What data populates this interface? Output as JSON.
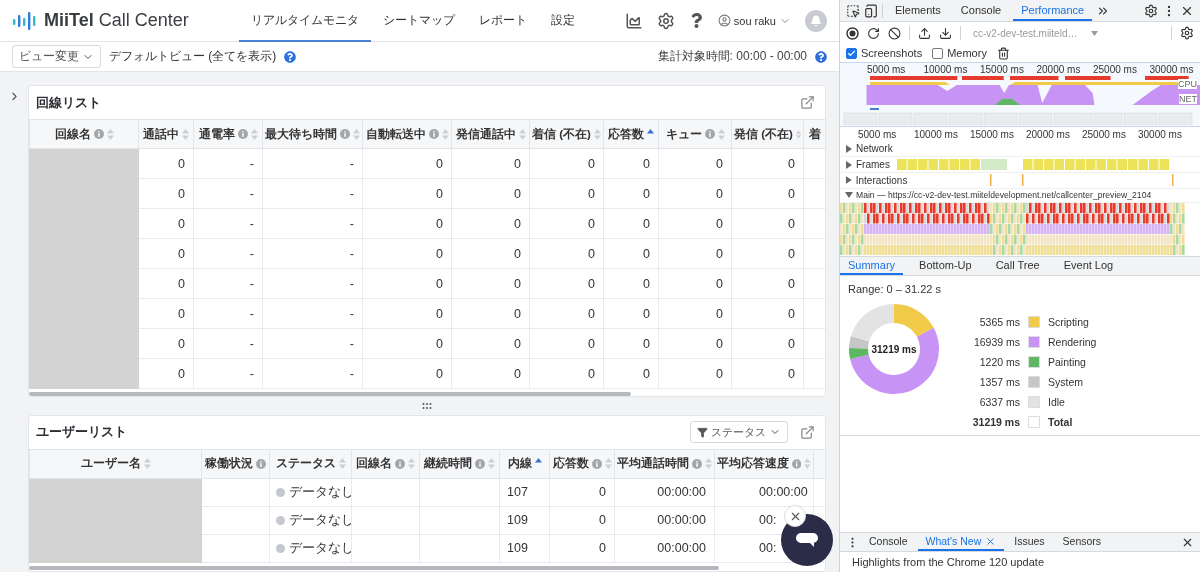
{
  "header": {
    "logo": "**MiiTel** Call Center",
    "nav": [
      {
        "label": "リアルタイムモニタ",
        "selected": true
      },
      {
        "label": "シートマップ",
        "selected": false
      },
      {
        "label": "レポート",
        "selected": false
      },
      {
        "label": "設定",
        "selected": false
      }
    ],
    "user": "sou raku"
  },
  "toolbar": {
    "view_button": "ビュー変更",
    "view_name": "デフォルトビュー (全てを表示)",
    "period": "集計対象時間: 00:00 - 00:00"
  },
  "line_list": {
    "title": "回線リスト",
    "columns": [
      {
        "label": "回線名",
        "info": true,
        "sort_active": false
      },
      {
        "label": "通話中",
        "info": false,
        "sort_active": false
      },
      {
        "label": "通電率",
        "info": true,
        "sort_active": false
      },
      {
        "label": "最大待ち時間",
        "info": true,
        "sort_active": false
      },
      {
        "label": "自動転送中",
        "info": true,
        "sort_active": false
      },
      {
        "label": "発信通話中",
        "info": false,
        "sort_active": false
      },
      {
        "label": "着信 (不在)",
        "info": false,
        "sort_active": false
      },
      {
        "label": "応答数",
        "info": false,
        "sort_active": true
      },
      {
        "label": "キュー",
        "info": true,
        "sort_active": false
      },
      {
        "label": "発信 (不在)",
        "info": false,
        "sort_active": false
      },
      {
        "label": "着",
        "info": false
      }
    ],
    "rows": [
      [
        "",
        "0",
        "-",
        "-",
        "0",
        "0",
        "0",
        "0",
        "0",
        "0",
        ""
      ],
      [
        "",
        "0",
        "-",
        "-",
        "0",
        "0",
        "0",
        "0",
        "0",
        "0",
        ""
      ],
      [
        "",
        "0",
        "-",
        "-",
        "0",
        "0",
        "0",
        "0",
        "0",
        "0",
        ""
      ],
      [
        "",
        "0",
        "-",
        "-",
        "0",
        "0",
        "0",
        "0",
        "0",
        "0",
        ""
      ],
      [
        "",
        "0",
        "-",
        "-",
        "0",
        "0",
        "0",
        "0",
        "0",
        "0",
        ""
      ],
      [
        "",
        "0",
        "-",
        "-",
        "0",
        "0",
        "0",
        "0",
        "0",
        "0",
        ""
      ],
      [
        "",
        "0",
        "-",
        "-",
        "0",
        "0",
        "0",
        "0",
        "0",
        "0",
        ""
      ],
      [
        "",
        "0",
        "-",
        "-",
        "0",
        "0",
        "0",
        "0",
        "0",
        "0",
        ""
      ]
    ]
  },
  "user_list": {
    "title": "ユーザーリスト",
    "filter": "ステータス",
    "columns": [
      {
        "label": "ユーザー名",
        "info": false,
        "sort_active": false
      },
      {
        "label": "稼働状況",
        "info": true
      },
      {
        "label": "ステータス",
        "info": false,
        "sort_active": false
      },
      {
        "label": "回線名",
        "info": true,
        "sort_active": false
      },
      {
        "label": "継続時間",
        "info": true,
        "sort_active": false
      },
      {
        "label": "内線",
        "info": false,
        "sort_active": true
      },
      {
        "label": "応答数",
        "info": true,
        "sort_active": false
      },
      {
        "label": "平均通話時間",
        "info": true,
        "sort_active": false
      },
      {
        "label": "平均応答速度",
        "info": true,
        "sort_active": false
      }
    ],
    "rows": [
      [
        "",
        "",
        "データなし",
        "",
        "",
        "107",
        "0",
        "00:00:00",
        "00:00:00"
      ],
      [
        "",
        "",
        "データなし",
        "",
        "",
        "109",
        "0",
        "00:00:00",
        "00:"
      ],
      [
        "",
        "",
        "データなし",
        "",
        "",
        "109",
        "0",
        "00:00:00",
        "00:"
      ]
    ]
  },
  "devtools": {
    "tabs": [
      {
        "label": "Elements",
        "selected": false
      },
      {
        "label": "Console",
        "selected": false
      },
      {
        "label": "Performance",
        "selected": true
      }
    ],
    "recording_select": "cc-v2-dev-test.miiteld…",
    "options": [
      {
        "label": "Screenshots",
        "checked": true
      },
      {
        "label": "Memory",
        "checked": false
      }
    ],
    "overview": {
      "ticks": [
        "5000 ms",
        "10000 ms",
        "15000 ms",
        "20000 ms",
        "25000 ms",
        "30000 ms"
      ],
      "cpu_label": "CPU",
      "net_label": "NET"
    },
    "timeline": {
      "ticks": [
        "5000 ms",
        "10000 ms",
        "15000 ms",
        "20000 ms",
        "25000 ms",
        "30000 ms"
      ],
      "tracks": [
        {
          "label": "Network",
          "expanded": false,
          "kind": "plain"
        },
        {
          "label": "Frames",
          "expanded": false,
          "kind": "frames"
        },
        {
          "label": "Interactions",
          "expanded": false,
          "kind": "interactions"
        },
        {
          "label": "Main — https://cc-v2-dev-test.miiteldevelopment.net/callcenter_preview_2104",
          "expanded": true,
          "kind": "main"
        }
      ]
    },
    "summary_tabs": [
      {
        "label": "Summary",
        "selected": true
      },
      {
        "label": "Bottom-Up",
        "selected": false
      },
      {
        "label": "Call Tree",
        "selected": false
      },
      {
        "label": "Event Log",
        "selected": false
      }
    ],
    "range": "Range: 0 – 31.22 s",
    "center_label": "31219 ms",
    "chart_data": {
      "type": "donut",
      "categories": [
        "Scripting",
        "Rendering",
        "Painting",
        "System",
        "Idle"
      ],
      "values": [
        17.18,
        54.26,
        3.91,
        4.35,
        20.3
      ]
    },
    "legend": [
      {
        "value": "5365 ms",
        "color": "#f2ca4a",
        "kind": "item"
      },
      {
        "value": "16939 ms",
        "color": "#c793f5",
        "kind": "item"
      },
      {
        "value": "1220 ms",
        "color": "#5db763",
        "kind": "item"
      },
      {
        "value": "1357 ms",
        "color": "#c6c6c6",
        "kind": "item"
      },
      {
        "value": "6337 ms",
        "color": "#e3e3e3",
        "kind": "item"
      },
      {
        "value": "31219 ms",
        "label": "Total",
        "color": "#ffffff",
        "kind": "total"
      }
    ],
    "drawer_tabs": [
      {
        "label": "Console",
        "selected": false,
        "closable": false
      },
      {
        "label": "What's New",
        "selected": true,
        "closable": true
      },
      {
        "label": "Issues",
        "selected": false,
        "closable": false
      },
      {
        "label": "Sensors",
        "selected": false,
        "closable": false
      }
    ],
    "drawer_text": "Highlights from the Chrome 120 update"
  }
}
